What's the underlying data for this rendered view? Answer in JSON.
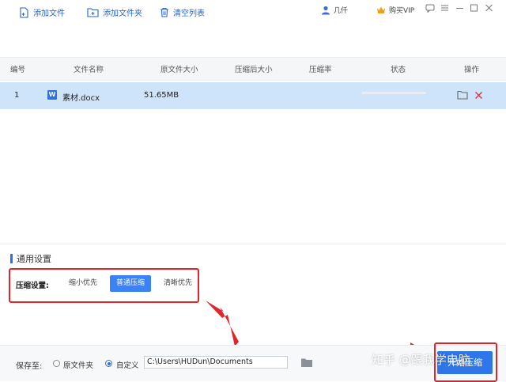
{
  "titlebar": {
    "user_name": "几仟",
    "vip_label": "购买VIP",
    "icons": [
      "user-icon",
      "vip-icon",
      "chat-icon",
      "minimize-icon",
      "maximize-icon",
      "close-icon"
    ]
  },
  "toolbar": {
    "add_file": "添加文件",
    "add_folder": "添加文件夹",
    "clear_list": "清空列表"
  },
  "table": {
    "headers": [
      "编号",
      "文件名称",
      "原文件大小",
      "压缩后大小",
      "压缩率",
      "状态",
      "操作"
    ],
    "rows": [
      {
        "index": "1",
        "file_icon": "W",
        "name": "素材.docx",
        "size": "51.65MB",
        "compressed_size": "",
        "ratio": "",
        "progress": 0.0
      }
    ]
  },
  "settings": {
    "title": "通用设置",
    "compress_label": "压缩设置:",
    "options": [
      "缩小优先",
      "普通压缩",
      "清晰优先"
    ],
    "selected": "普通压缩"
  },
  "save": {
    "label": "保存至:",
    "option_original": "原文件夹",
    "option_custom": "自定义",
    "selected": "自定义",
    "path": "C:\\Users\\HUDun\\Documents"
  },
  "start_button": "开始压缩",
  "watermark": "知乎 @跟我学电脑",
  "colors": {
    "accent": "#2f76e8",
    "row_selected": "#cde4fb",
    "annotation_red": "#e0262b"
  }
}
